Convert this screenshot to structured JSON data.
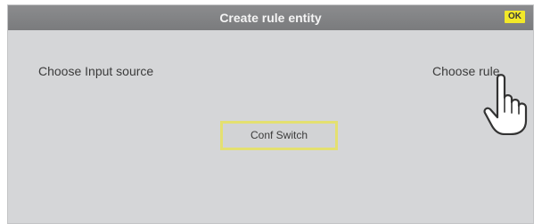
{
  "window": {
    "title": "Create rule entity",
    "ok_label": "OK"
  },
  "main": {
    "choose_input_label": "Choose Input source",
    "choose_rule_label": "Choose rule",
    "conf_switch_label": "Conf Switch"
  },
  "icons": {
    "pointer": "hand-pointer-icon"
  },
  "colors": {
    "titlebar": "#7f8082",
    "background": "#d5d6d8",
    "ok_button": "#f2e829",
    "highlight_border": "#e4e070"
  }
}
